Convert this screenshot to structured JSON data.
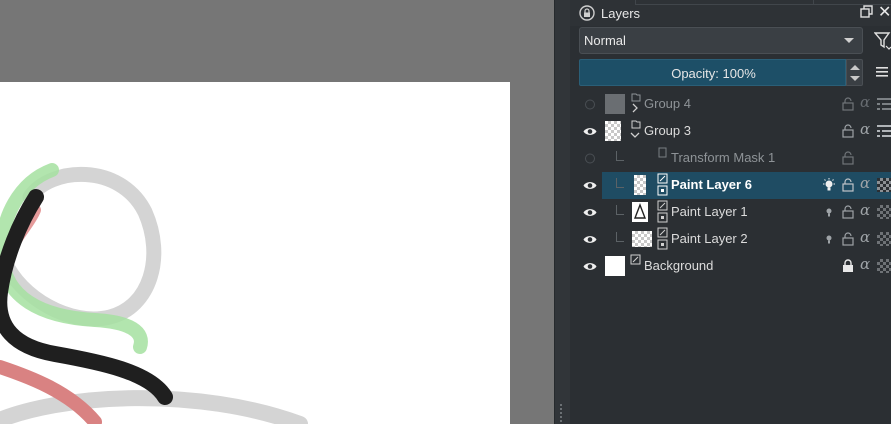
{
  "docker": {
    "title": "Layers",
    "blend_mode": "Normal",
    "opacity_text": "Opacity:  100%",
    "opacity_value": 100
  },
  "layers": [
    {
      "name": "Group 4",
      "type": "group",
      "visible": false,
      "selected": false,
      "depth": 0,
      "collapsed": true
    },
    {
      "name": "Group 3",
      "type": "group",
      "visible": true,
      "selected": false,
      "depth": 0,
      "collapsed": false
    },
    {
      "name": "Transform Mask 1",
      "type": "transform-mask",
      "visible": false,
      "selected": false,
      "depth": 1
    },
    {
      "name": "Paint Layer 6",
      "type": "paint",
      "visible": true,
      "selected": true,
      "depth": 1
    },
    {
      "name": "Paint Layer 1",
      "type": "paint",
      "visible": true,
      "selected": false,
      "depth": 1
    },
    {
      "name": "Paint Layer 2",
      "type": "paint",
      "visible": true,
      "selected": false,
      "depth": 1
    },
    {
      "name": "Background",
      "type": "paint",
      "visible": true,
      "selected": false,
      "depth": 0,
      "locked": true
    }
  ],
  "colors": {
    "canvas_bg": "#767676",
    "docker_bg": "#2b2f33",
    "selection": "#1f4c63",
    "opacity_bar": "#1d4f67"
  }
}
